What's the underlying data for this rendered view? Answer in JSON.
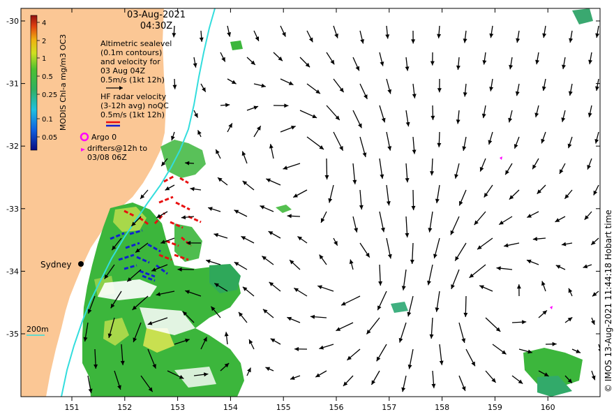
{
  "title": {
    "date": "03-Aug-2021",
    "time": "04:30Z"
  },
  "legend": {
    "altimetry_lines": [
      "Altimetric sealevel",
      "(0.1m contours)",
      "and velocity for",
      "03 Aug 04Z",
      "0.5m/s (1kt 12h)"
    ],
    "hf_lines": [
      "HF radar velocity",
      "(3-12h avg) noQC",
      "0.5m/s (1kt 12h)"
    ],
    "argo": "Argo 0",
    "drifter_lines": [
      "drifters@12h to",
      "03/08 06Z"
    ]
  },
  "colorbar": {
    "title": "MODIS Chl-a mg/m3 OC3",
    "ticks": [
      "4",
      "2",
      "1",
      "0.5",
      "0.25",
      "0.1",
      "0.05"
    ]
  },
  "place_label": "Sydney",
  "depth_label": "200m",
  "credit": "© IMOS 13-Aug-2021 11:44:18 Hobart time",
  "axes": {
    "x_ticks": [
      "151",
      "152",
      "153",
      "154",
      "155",
      "156",
      "157",
      "158",
      "159",
      "160"
    ],
    "y_ticks": [
      "-30",
      "-31",
      "-32",
      "-33",
      "-34",
      "-35"
    ]
  },
  "colors": {
    "land": "#fbc795",
    "shelf_line": "#33dddd",
    "chl_green": "#3cb63c",
    "hf_red": "#e81010",
    "hf_blue": "#1020d0",
    "argo": "#ff00ff"
  }
}
